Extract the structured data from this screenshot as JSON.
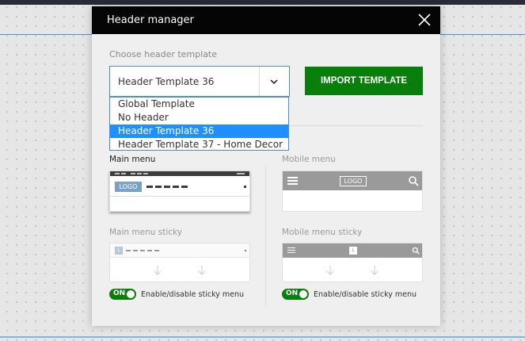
{
  "modal": {
    "title": "Header manager",
    "choose_label": "Choose header template",
    "selected_template": "Header Template 36",
    "import_button": "IMPORT TEMPLATE"
  },
  "dropdown": {
    "options": [
      "Global Template",
      "No Header",
      "Header Template 36",
      "Header Template 37 - Home Decor"
    ],
    "highlighted": "Header Template 36"
  },
  "sections": {
    "main_menu": "Main menu",
    "mobile_menu": "Mobile menu",
    "main_menu_sticky": "Main menu sticky",
    "mobile_menu_sticky": "Mobile menu sticky"
  },
  "previews": {
    "logo_text": "LOGO",
    "mini_logo_text": "L"
  },
  "toggles": {
    "main_sticky": {
      "state": "ON",
      "label": "Enable/disable sticky menu"
    },
    "mobile_sticky": {
      "state": "ON",
      "label": "Enable/disable sticky menu"
    }
  },
  "colors": {
    "accent_green": "#087e0b",
    "highlight_blue": "#1e90ff",
    "header_black": "#050505"
  },
  "icons": [
    "close-icon",
    "chevron-down-icon",
    "hamburger-icon",
    "search-icon",
    "arrow-down-icon"
  ]
}
